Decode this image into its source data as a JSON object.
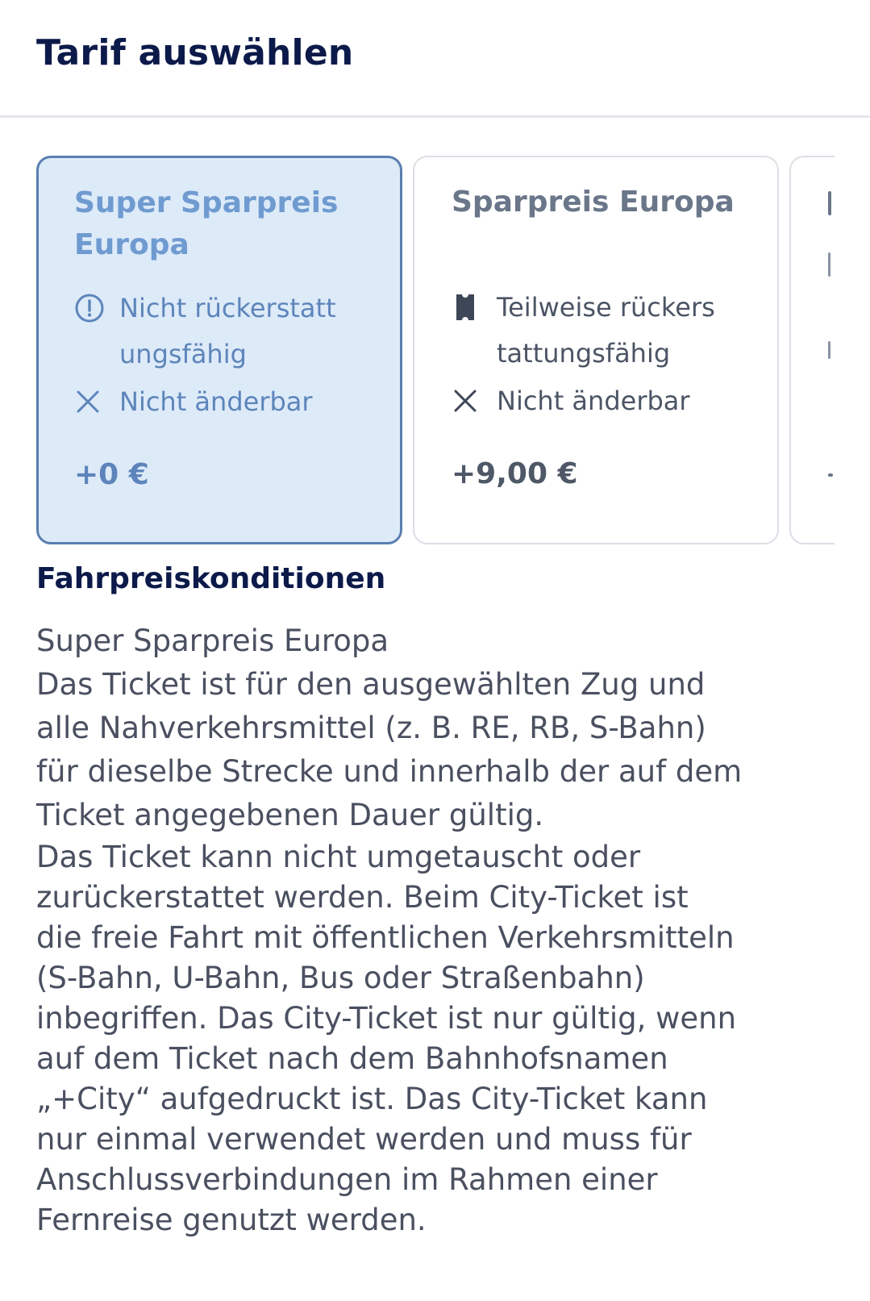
{
  "header": {
    "title": "Tarif auswählen"
  },
  "fares": [
    {
      "name": "Super Sparpreis Europa",
      "selected": true,
      "refund_icon": "info-circle-icon",
      "refund_line1": "Nicht rückerstatt",
      "refund_line2": "ungsfähig",
      "change_icon": "close-x-icon",
      "change_text": "Nicht änderbar",
      "price": "+0 €"
    },
    {
      "name": "Sparpreis Europa",
      "selected": false,
      "refund_icon": "ticket-icon",
      "refund_line1": "Teilweise rückers",
      "refund_line2": "tattungsfähig",
      "change_icon": "close-x-icon",
      "change_text": "Nicht änderbar",
      "price": "+9,00 €"
    }
  ],
  "conditions": {
    "title": "Fahrpreiskonditionen",
    "lines": [
      "Super Sparpreis Europa",
      "Das Ticket ist für den ausgewählten Zug und",
      "alle Nahverkehrsmittel (z. B. RE, RB, S-Bahn)",
      "für dieselbe Strecke und innerhalb der auf dem",
      "Ticket angegebenen Dauer gültig.",
      "Das Ticket kann nicht umgetauscht oder",
      "zurückerstattet werden. Beim City-Ticket ist",
      "die freie Fahrt mit öffentlichen Verkehrsmitteln",
      "(S-Bahn, U-Bahn, Bus oder Straßenbahn)",
      "inbegriffen. Das City-Ticket ist nur gültig, wenn",
      "auf dem Ticket nach dem Bahnhofsnamen",
      "„+City“ aufgedruckt ist. Das City-Ticket kann",
      "nur einmal verwendet werden und muss für",
      "Anschlussverbindungen im Rahmen einer",
      "Fernreise genutzt werden."
    ]
  },
  "colors": {
    "title": "#0c1a4a",
    "selected_card_bg": "#ddeaf8",
    "selected_card_border": "#5a7fb0",
    "selected_text": "#5d85bb",
    "card_border": "#dcdfe5",
    "body_text": "#4a5060"
  }
}
